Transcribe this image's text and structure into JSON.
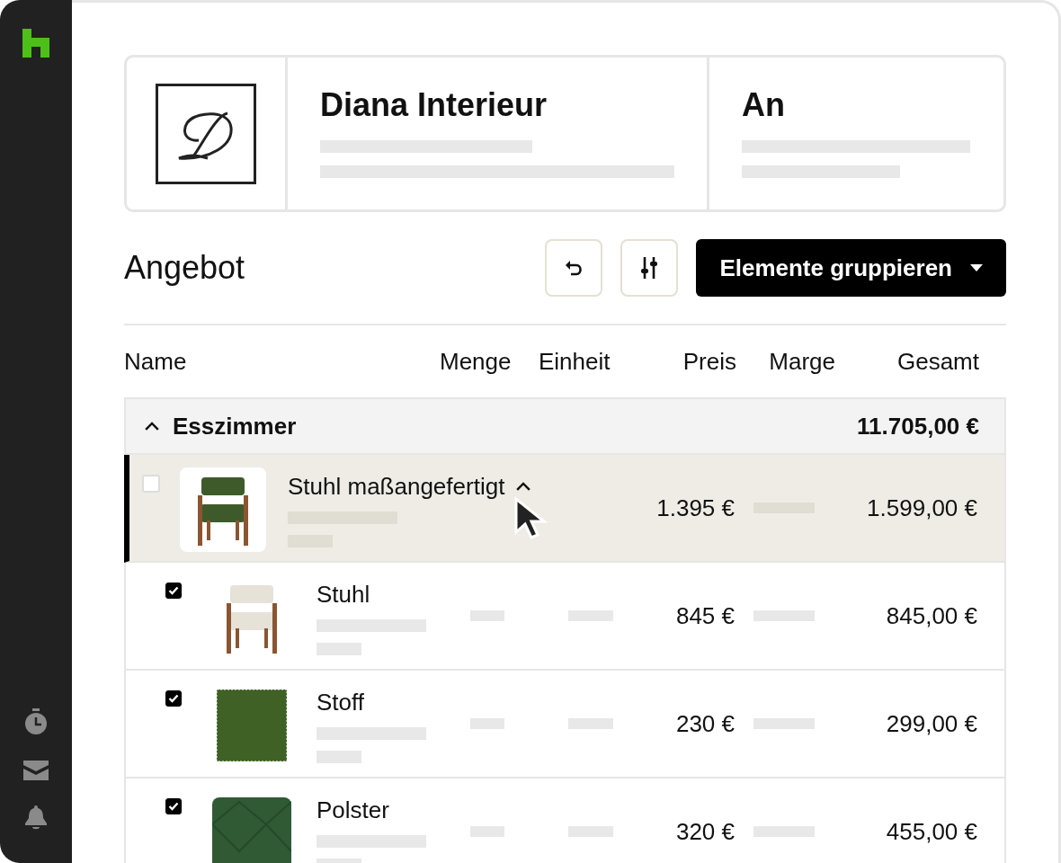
{
  "header": {
    "company": "Diana Interieur",
    "recipient": "An"
  },
  "toolbar": {
    "title": "Angebot",
    "group_button": "Elemente gruppieren"
  },
  "table": {
    "columns": [
      "Name",
      "Menge",
      "Einheit",
      "Preis",
      "Marge",
      "Gesamt"
    ],
    "group": {
      "name": "Esszimmer",
      "total": "11.705,00 €",
      "expanded": true
    },
    "parent": {
      "name": "Stuhl maßangefertigt",
      "price": "1.395 €",
      "total": "1.599,00 €",
      "checked": false,
      "selected": true,
      "expanded": true,
      "kind": "chair"
    },
    "children": [
      {
        "name": "Stuhl",
        "price": "845 €",
        "total": "845,00 €",
        "checked": true,
        "kind": "upholstered"
      },
      {
        "name": "Stoff",
        "price": "230 €",
        "total": "299,00 €",
        "checked": true,
        "kind": "fabric"
      },
      {
        "name": "Polster",
        "price": "320 €",
        "total": "455,00 €",
        "checked": true,
        "kind": "padding"
      }
    ]
  }
}
